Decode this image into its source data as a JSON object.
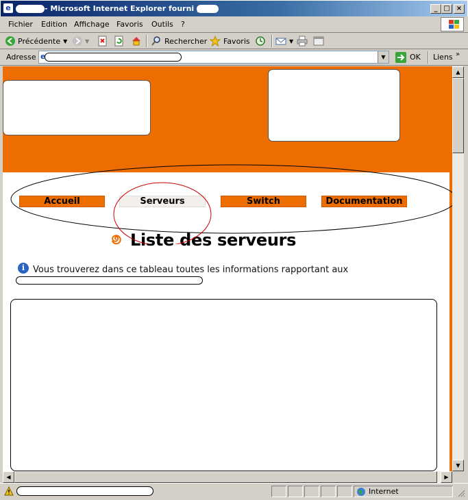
{
  "window": {
    "title_suffix": "- Microsoft Internet Explorer fourni par",
    "app_icon": "ie-icon"
  },
  "menu": {
    "items": [
      "Fichier",
      "Edition",
      "Affichage",
      "Favoris",
      "Outils",
      "?"
    ]
  },
  "toolbar": {
    "back_label": "Précédente",
    "search_label": "Rechercher",
    "favorites_label": "Favoris"
  },
  "address": {
    "label": "Adresse",
    "go_label": "OK",
    "links_label": "Liens"
  },
  "page": {
    "nav": [
      "Accueil",
      "Serveurs",
      "Switch",
      "Documentation"
    ],
    "heading": "Liste des serveurs",
    "info_text": "Vous trouverez dans ce tableau toutes les informations rapportant aux"
  },
  "status": {
    "zone_label": "Internet"
  },
  "colors": {
    "banner": "#ee6d00",
    "titlebar_start": "#0a246a",
    "titlebar_end": "#a6caf0",
    "annotation_ellipse": "#000000",
    "annotation_circle": "#cc0000"
  }
}
